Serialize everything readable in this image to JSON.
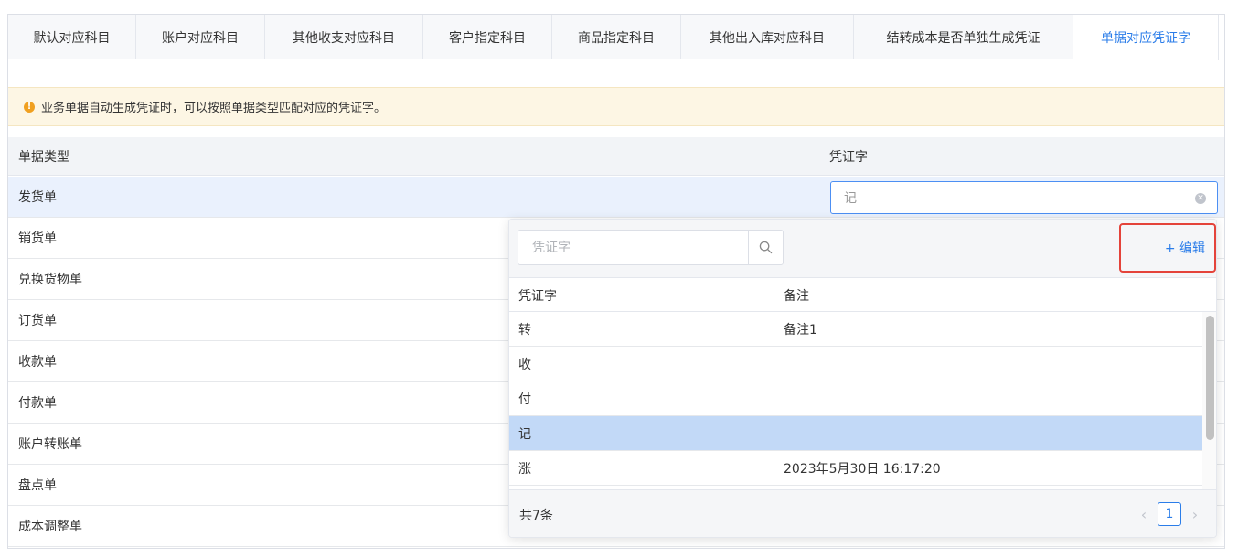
{
  "tabs": [
    {
      "label": "默认对应科目"
    },
    {
      "label": "账户对应科目"
    },
    {
      "label": "其他收支对应科目"
    },
    {
      "label": "客户指定科目"
    },
    {
      "label": "商品指定科目"
    },
    {
      "label": "其他出入库对应科目"
    },
    {
      "label": "结转成本是否单独生成凭证"
    },
    {
      "label": "单据对应凭证字"
    }
  ],
  "notice": {
    "icon": "warning-icon",
    "text": "业务单据自动生成凭证时，可以按照单据类型匹配对应的凭证字。"
  },
  "table": {
    "columns": {
      "doc_type": "单据类型",
      "voucher": "凭证字"
    },
    "rows": [
      {
        "doc_type": "发货单"
      },
      {
        "doc_type": "销货单"
      },
      {
        "doc_type": "兑换货物单"
      },
      {
        "doc_type": "订货单"
      },
      {
        "doc_type": "收款单"
      },
      {
        "doc_type": "付款单"
      },
      {
        "doc_type": "账户转账单"
      },
      {
        "doc_type": "盘点单"
      },
      {
        "doc_type": "成本调整单"
      }
    ],
    "selected_value": "记"
  },
  "dropdown": {
    "search_placeholder": "凭证字",
    "edit_label": "+ 编辑",
    "columns": {
      "voucher": "凭证字",
      "remark": "备注"
    },
    "rows": [
      {
        "voucher": "转",
        "remark": "备注1"
      },
      {
        "voucher": "收",
        "remark": ""
      },
      {
        "voucher": "付",
        "remark": ""
      },
      {
        "voucher": "记",
        "remark": ""
      },
      {
        "voucher": "涨",
        "remark": "2023年5月30日 16:17:20"
      }
    ],
    "total": "共7条",
    "page": "1",
    "prev_icon": "chevron-left-icon",
    "next_icon": "chevron-right-icon"
  },
  "colors": {
    "accent": "#2b7de9",
    "highlight": "#e4433a",
    "selected_row": "#c2d9f7"
  }
}
